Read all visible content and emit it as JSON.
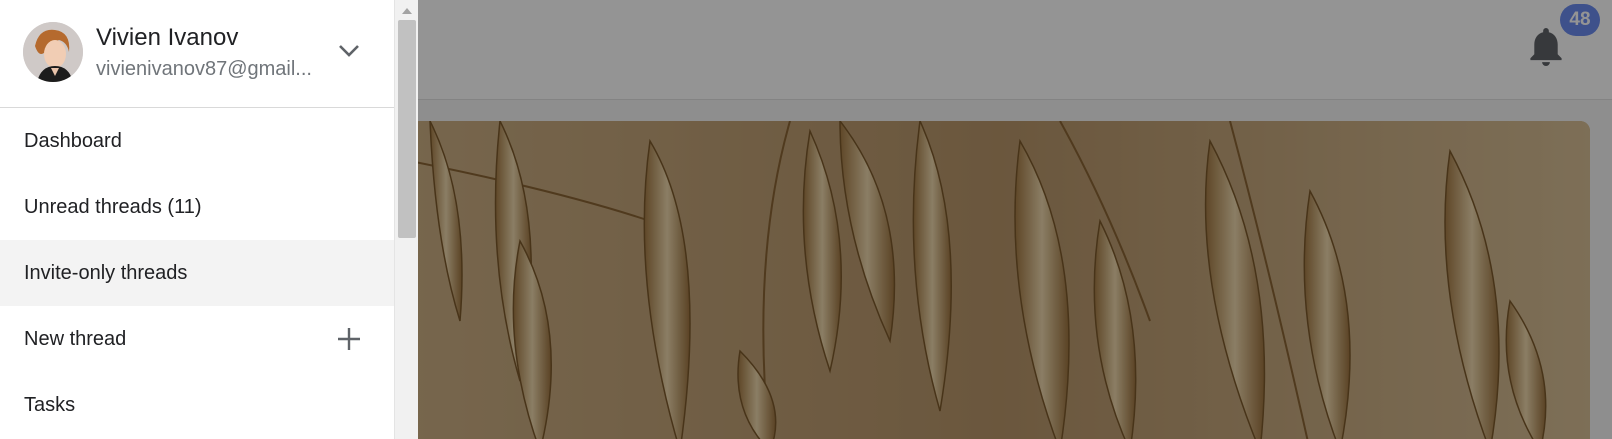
{
  "colors": {
    "badge_bg": "#6c8cf0",
    "scrim": "rgba(0,0,0,0.42)",
    "drawer_bg": "#ffffff",
    "active_item_bg": "#f3f3f3"
  },
  "header": {
    "notification_count": "48",
    "notification_icon": "bell-icon"
  },
  "hero": {
    "image_subject": "oat-stalks"
  },
  "drawer": {
    "account": {
      "name": "Vivien Ivanov",
      "email": "vivienivanov87@gmail...",
      "toggle_icon": "chevron-down-icon"
    },
    "items": [
      {
        "label": "Dashboard",
        "active": false
      },
      {
        "label": "Unread threads (11)",
        "active": false
      },
      {
        "label": "Invite-only threads",
        "active": true
      },
      {
        "label": "New thread",
        "active": false,
        "action_icon": "plus-icon"
      },
      {
        "label": "Tasks",
        "active": false
      }
    ]
  }
}
